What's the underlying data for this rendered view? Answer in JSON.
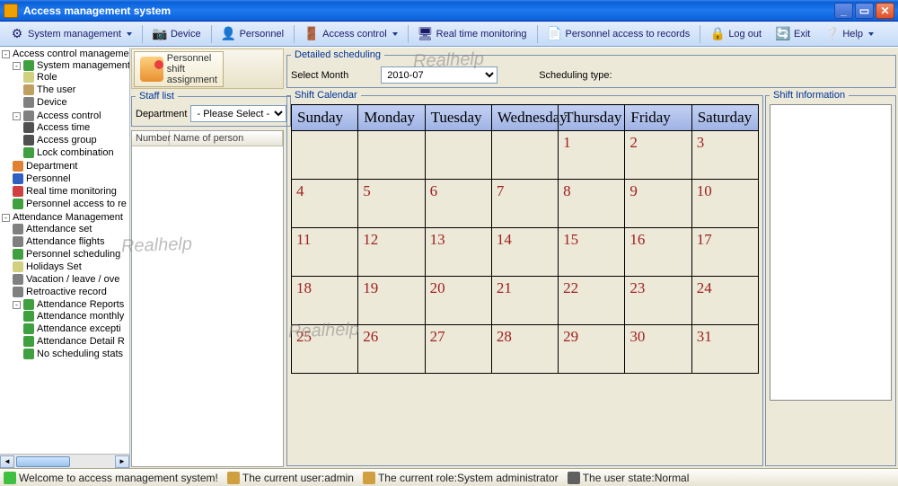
{
  "app_title": "Access management system",
  "toolbar": {
    "system_management": "System management",
    "device": "Device",
    "personnel": "Personnel",
    "access_control": "Access control",
    "real_time_monitoring": "Real time monitoring",
    "personnel_access_to_records": "Personnel access to records",
    "log_out": "Log out",
    "exit": "Exit",
    "help": "Help"
  },
  "tree": {
    "root1": "Access control management",
    "sys_mgmt": "System management",
    "role": "Role",
    "the_user": "The user",
    "device": "Device",
    "access_control": "Access control",
    "access_time": "Access time",
    "access_group": "Access group",
    "lock_combination": "Lock combination",
    "department": "Department",
    "personnel": "Personnel",
    "real_time_monitoring": "Real time monitoring",
    "personnel_access_to_re": "Personnel access to re",
    "root2": "Attendance Management",
    "attendance_set": "Attendance set",
    "attendance_flights": "Attendance flights",
    "personnel_scheduling": "Personnel scheduling",
    "holidays_set": "Holidays Set",
    "vacation": "Vacation / leave / ove",
    "retroactive": "Retroactive record",
    "attendance_reports": "Attendance Reports",
    "attendance_monthly": "Attendance monthly",
    "attendance_excepti": "Attendance excepti",
    "attendance_detail": "Attendance Detail R",
    "no_scheduling": "No scheduling stats"
  },
  "bigbtn": {
    "line1": "Personnel",
    "line2": "shift",
    "line3": "assignment"
  },
  "staff": {
    "legend": "Staff list",
    "dept_label": "Department",
    "dept_placeholder": "- Please Select -",
    "col_number": "Number",
    "col_name": "Name of person"
  },
  "detail": {
    "legend": "Detailed scheduling",
    "select_month_label": "Select Month",
    "month_value": "2010-07",
    "sched_type_label": "Scheduling type:"
  },
  "calendar": {
    "legend": "Shift Calendar",
    "days": [
      "Sunday",
      "Monday",
      "Tuesday",
      "Wednesday",
      "Thursday",
      "Friday",
      "Saturday"
    ],
    "weeks": [
      [
        "",
        "",
        "",
        "",
        "1",
        "2",
        "3"
      ],
      [
        "4",
        "5",
        "6",
        "7",
        "8",
        "9",
        "10"
      ],
      [
        "11",
        "12",
        "13",
        "14",
        "15",
        "16",
        "17"
      ],
      [
        "18",
        "19",
        "20",
        "21",
        "22",
        "23",
        "24"
      ],
      [
        "25",
        "26",
        "27",
        "28",
        "29",
        "30",
        "31"
      ]
    ]
  },
  "shift_info": {
    "legend": "Shift Information"
  },
  "status": {
    "welcome": "Welcome to access management system!",
    "current_user": "The current user:admin",
    "current_role": "The current role:System administrator",
    "user_state": "The user state:Normal"
  },
  "watermark": "Realhelp"
}
